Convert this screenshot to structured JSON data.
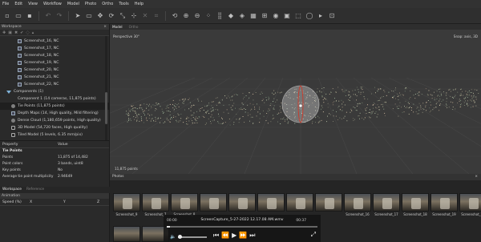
{
  "menu": [
    "File",
    "Edit",
    "View",
    "Workflow",
    "Model",
    "Photo",
    "Ortho",
    "Tools",
    "Help"
  ],
  "workspace": {
    "title": "Workspace",
    "tree": [
      {
        "label": "Screenshot_16, NC",
        "icon": "image-icon",
        "indent": 22
      },
      {
        "label": "Screenshot_17, NC",
        "icon": "image-icon",
        "indent": 22
      },
      {
        "label": "Screenshot_18, NC",
        "icon": "image-icon",
        "indent": 22
      },
      {
        "label": "Screenshot_19, NC",
        "icon": "image-icon",
        "indent": 22
      },
      {
        "label": "Screenshot_20, NC",
        "icon": "image-icon",
        "indent": 22
      },
      {
        "label": "Screenshot_21, NC",
        "icon": "image-icon",
        "indent": 22
      },
      {
        "label": "Screenshot_22, NC",
        "icon": "image-icon",
        "indent": 22
      },
      {
        "label": "Components (1)",
        "icon": "expand-icon",
        "indent": 8
      },
      {
        "label": "Component 1 (14 cameras, 11,875 points)",
        "icon": "none",
        "indent": 22
      },
      {
        "label": "Tie Points (11,875 points)",
        "icon": "points-icon",
        "indent": 14
      },
      {
        "label": "Depth Maps (14, High quality, Mild filtering)",
        "icon": "depth-icon",
        "indent": 14
      },
      {
        "label": "Dense Cloud (1,180,659 points, High quality)",
        "icon": "cloud-icon",
        "indent": 14
      },
      {
        "label": "3D Model (54,720 faces, High quality)",
        "icon": "model-icon",
        "indent": 14
      },
      {
        "label": "Tiled Model (5 levels, 6.35 mm/pix)",
        "icon": "tiled-icon",
        "indent": 14
      }
    ]
  },
  "properties": {
    "col_property": "Property",
    "col_value": "Value",
    "rows": [
      {
        "k": "Tie Points",
        "v": "",
        "section": true
      },
      {
        "k": "Points",
        "v": "11,875 of 14,482"
      },
      {
        "k": "Point colors",
        "v": "3 bands, uint8"
      },
      {
        "k": "Key points",
        "v": "No"
      },
      {
        "k": "Average tie point multiplicity",
        "v": "2.94649"
      }
    ]
  },
  "left_tabs": {
    "active": "Workspace",
    "inactive": "Reference"
  },
  "animation": {
    "title": "Animation",
    "cols": [
      "Speed (%)",
      "X",
      "Y",
      "Z"
    ]
  },
  "viewport": {
    "tabs": {
      "active": "Model",
      "inactive": "Ortho"
    },
    "perspective": "Perspective 30°",
    "snap": "Snap: axis, 3D",
    "points": "11,875 points"
  },
  "photos_title": "Photos",
  "photos": [
    "Screenshot_9",
    "Screenshot_7",
    "Screenshot_8",
    "",
    "",
    "",
    "",
    "",
    "Screenshot_16",
    "Screenshot_17",
    "Screenshot_18",
    "Screenshot_19",
    "Screenshot_20"
  ],
  "player": {
    "file": "ScreenCapture_5-27-2022 12.17.08 AM.wmv",
    "time_start": "00:00",
    "time_end": "00:37",
    "progress": 0.02
  },
  "colors": {
    "accent": "#cc3a2a",
    "viewport_bg": "#3a3a3a"
  }
}
